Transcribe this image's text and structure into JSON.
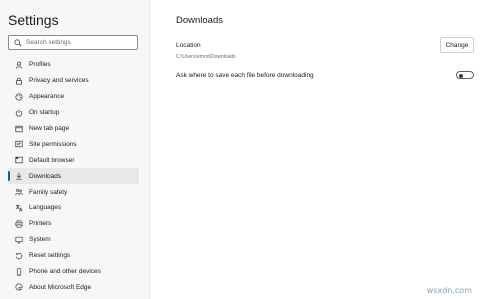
{
  "sidebar": {
    "title": "Settings",
    "search": {
      "placeholder": "Search settings",
      "value": ""
    },
    "items": [
      {
        "label": "Profiles",
        "icon": "profile-icon",
        "active": false
      },
      {
        "label": "Privacy and services",
        "icon": "lock-icon",
        "active": false
      },
      {
        "label": "Appearance",
        "icon": "palette-icon",
        "active": false
      },
      {
        "label": "On startup",
        "icon": "power-icon",
        "active": false
      },
      {
        "label": "New tab page",
        "icon": "new-tab-icon",
        "active": false
      },
      {
        "label": "Site permissions",
        "icon": "permissions-icon",
        "active": false
      },
      {
        "label": "Default browser",
        "icon": "browser-icon",
        "active": false
      },
      {
        "label": "Downloads",
        "icon": "download-icon",
        "active": true
      },
      {
        "label": "Family safety",
        "icon": "family-icon",
        "active": false
      },
      {
        "label": "Languages",
        "icon": "languages-icon",
        "active": false
      },
      {
        "label": "Printers",
        "icon": "printer-icon",
        "active": false
      },
      {
        "label": "System",
        "icon": "system-icon",
        "active": false
      },
      {
        "label": "Reset settings",
        "icon": "reset-icon",
        "active": false
      },
      {
        "label": "Phone and other devices",
        "icon": "phone-icon",
        "active": false
      },
      {
        "label": "About Microsoft Edge",
        "icon": "edge-icon",
        "active": false
      }
    ]
  },
  "main": {
    "title": "Downloads",
    "location": {
      "label": "Location",
      "path": "C:\\Users\\emrot\\Downloads",
      "button_label": "Change"
    },
    "ask_setting": {
      "label": "Ask where to save each file before downloading",
      "enabled": false
    }
  },
  "watermark": "wsxdn.com",
  "colors": {
    "accent": "#0067c0",
    "sidebar_bg": "#f7f7f7",
    "active_item_bg": "#e8e8e8"
  }
}
